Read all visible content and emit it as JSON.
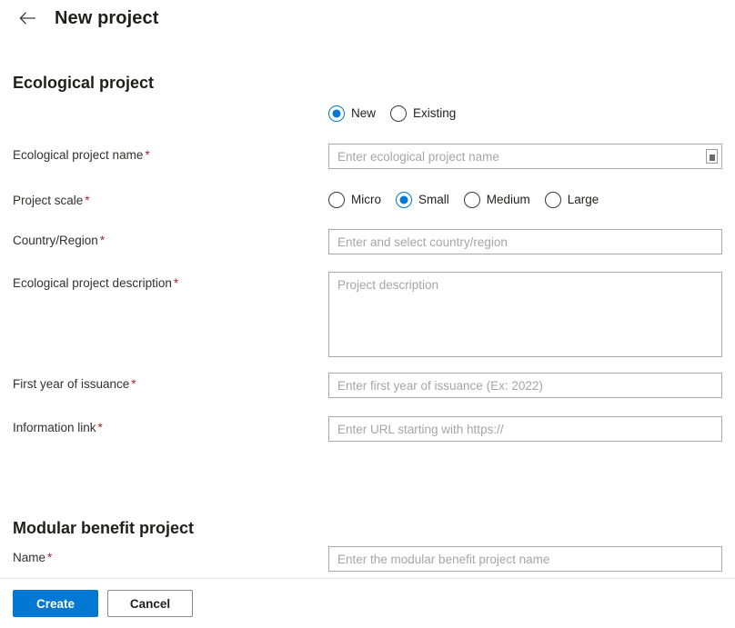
{
  "header": {
    "back_icon": "arrow-left-icon",
    "title": "New project"
  },
  "sections": [
    {
      "heading": "Ecological project",
      "fields": [
        {
          "label": "Ecological project name",
          "required_mark": "*",
          "placeholder": "Enter ecological project name",
          "trailing_icon": "ime-mode-icon"
        },
        {
          "label": "Project scale",
          "required_mark": "*"
        },
        {
          "label": "Country/Region",
          "required_mark": "*",
          "placeholder": "Enter and select country/region"
        },
        {
          "label": "Ecological project description",
          "required_mark": "*",
          "placeholder": "Project description"
        },
        {
          "label": "First year of issuance",
          "required_mark": "*",
          "placeholder": "Enter first year of issuance (Ex: 2022)"
        },
        {
          "label": "Information link",
          "required_mark": "*",
          "placeholder": "Enter URL starting with https://"
        }
      ]
    },
    {
      "heading": "Modular benefit project",
      "fields": [
        {
          "label": "Name",
          "required_mark": "*",
          "placeholder": "Enter the modular benefit project name"
        }
      ]
    }
  ],
  "project_type_radios": {
    "selected": "New",
    "options": [
      {
        "label": "New",
        "checked": true
      },
      {
        "label": "Existing",
        "checked": false
      }
    ]
  },
  "project_scale_radios": {
    "selected": "Small",
    "options": [
      {
        "label": "Micro",
        "checked": false
      },
      {
        "label": "Small",
        "checked": true
      },
      {
        "label": "Medium",
        "checked": false
      },
      {
        "label": "Large",
        "checked": false
      }
    ]
  },
  "footer": {
    "create_label": "Create",
    "cancel_label": "Cancel"
  },
  "colors": {
    "accent": "#0078d4",
    "required_asterisk": "#a4262c",
    "text": "#201f1e",
    "placeholder": "#a6a6a6",
    "border": "#a9a9a9",
    "divider": "#e6e6e6"
  }
}
